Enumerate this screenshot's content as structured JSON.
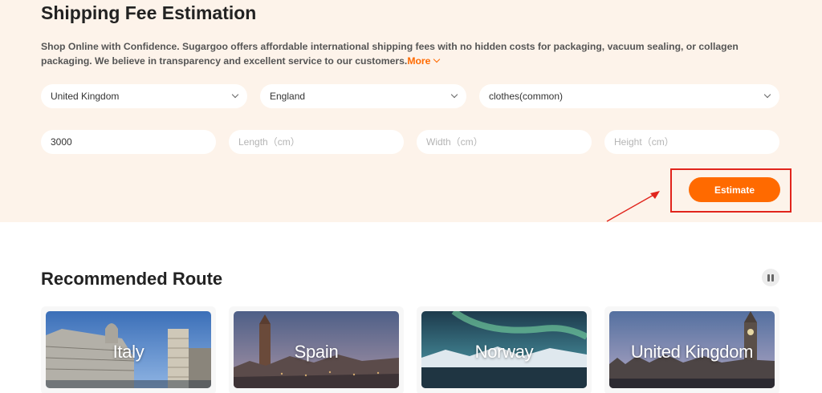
{
  "header": {
    "title": "Shipping Fee Estimation",
    "description": "Shop Online with Confidence. Sugargoo offers affordable international shipping fees with no hidden costs for packaging, vacuum sealing, or collagen packaging. We believe in transparency and excellent service to our customers.",
    "more_label": "More"
  },
  "form": {
    "country": "United Kingdom",
    "region": "England",
    "category": "clothes(common)",
    "weight_value": "3000",
    "length_placeholder": "Length（cm）",
    "width_placeholder": "Width（cm）",
    "height_placeholder": "Height（cm）",
    "estimate_label": "Estimate"
  },
  "routes": {
    "title": "Recommended Route",
    "items": [
      {
        "name": "Italy"
      },
      {
        "name": "Spain"
      },
      {
        "name": "Norway"
      },
      {
        "name": "United Kingdom"
      }
    ]
  },
  "icons": [
    "chevron-down-icon",
    "pause-icon",
    "annotation-arrow"
  ],
  "colors": {
    "accent": "#ff6a00",
    "highlight": "#e1241c",
    "top_bg": "#fdf3ea"
  }
}
